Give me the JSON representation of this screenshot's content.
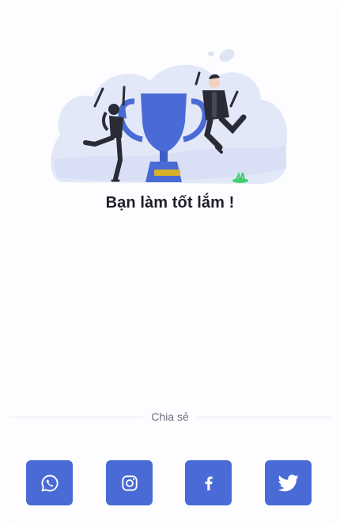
{
  "result": {
    "title": "Bạn làm tốt lắm !"
  },
  "share": {
    "label": "Chia sẻ",
    "buttons": [
      {
        "id": "whatsapp",
        "icon": "whatsapp-icon"
      },
      {
        "id": "instagram",
        "icon": "instagram-icon"
      },
      {
        "id": "facebook",
        "icon": "facebook-icon"
      },
      {
        "id": "twitter",
        "icon": "twitter-icon"
      }
    ]
  },
  "colors": {
    "accent": "#4a6bd6",
    "cloud": "#e3e8f8",
    "trophy_plate": "#d8b12a",
    "text": "#1d1f2b"
  }
}
